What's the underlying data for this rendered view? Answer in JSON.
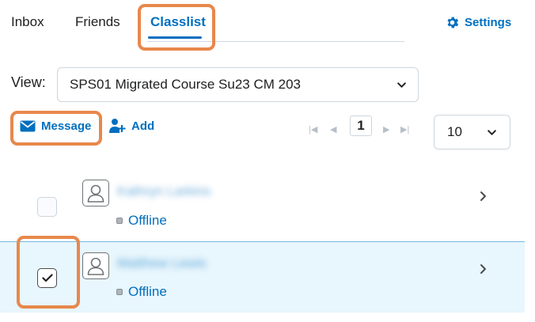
{
  "tabs": {
    "inbox": "Inbox",
    "friends": "Friends",
    "classlist": "Classlist",
    "active": "Classlist"
  },
  "settings": {
    "label": "Settings",
    "icon": "gear-icon"
  },
  "view": {
    "label": "View:",
    "selected": "SPS01 Migrated Course Su23 CM 203"
  },
  "actions": {
    "message_label": "Message",
    "add_label": "Add"
  },
  "pagination": {
    "current_page": "1"
  },
  "page_size": {
    "selected": "10"
  },
  "rows": [
    {
      "name": "Kathryn Larkins",
      "status": "Offline",
      "checked": false
    },
    {
      "name": "Matthew Lewis",
      "status": "Offline",
      "checked": true
    }
  ],
  "colors": {
    "accent": "#006fbf",
    "highlight_outline": "#e8884c",
    "selected_row": "#e8f6fd"
  }
}
